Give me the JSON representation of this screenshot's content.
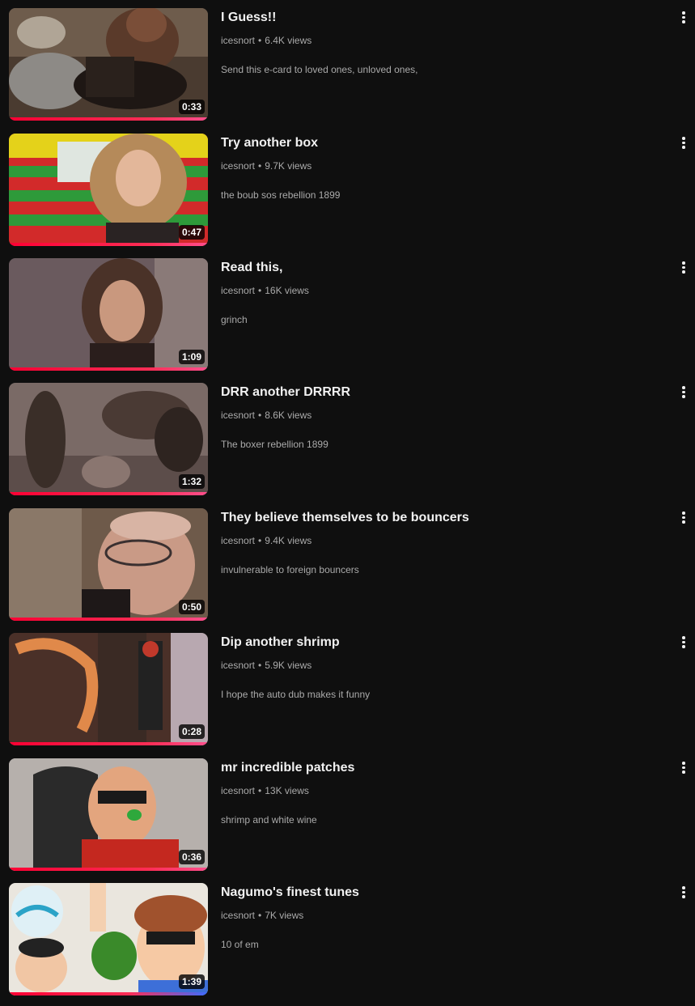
{
  "videos": [
    {
      "title": "I Guess!!",
      "channel": "icesnort",
      "views": "6.4K views",
      "description": "Send this e-card to loved ones, unloved ones,",
      "duration": "0:33"
    },
    {
      "title": "Try another box",
      "channel": "icesnort",
      "views": "9.7K views",
      "description": "the boub sos rebellion 1899",
      "duration": "0:47"
    },
    {
      "title": "Read this,",
      "channel": "icesnort",
      "views": "16K views",
      "description": "grinch",
      "duration": "1:09"
    },
    {
      "title": "DRR another DRRRR",
      "channel": "icesnort",
      "views": "8.6K views",
      "description": "The boxer rebellion 1899",
      "duration": "1:32"
    },
    {
      "title": "They believe themselves to be bouncers",
      "channel": "icesnort",
      "views": "9.4K views",
      "description": "invulnerable to foreign bouncers",
      "duration": "0:50"
    },
    {
      "title": "Dip another shrimp",
      "channel": "icesnort",
      "views": "5.9K views",
      "description": "I hope the auto dub makes it funny",
      "duration": "0:28"
    },
    {
      "title": "mr incredible patches",
      "channel": "icesnort",
      "views": "13K views",
      "description": "shrimp and white wine",
      "duration": "0:36"
    },
    {
      "title": "Nagumo's finest tunes",
      "channel": "icesnort",
      "views": "7K views",
      "description": "10 of em",
      "duration": "1:39"
    }
  ],
  "separator": "•",
  "icons": {
    "more": "more-vert-icon"
  },
  "colors": {
    "background": "#0f0f0f",
    "progress": "#ff0033"
  }
}
